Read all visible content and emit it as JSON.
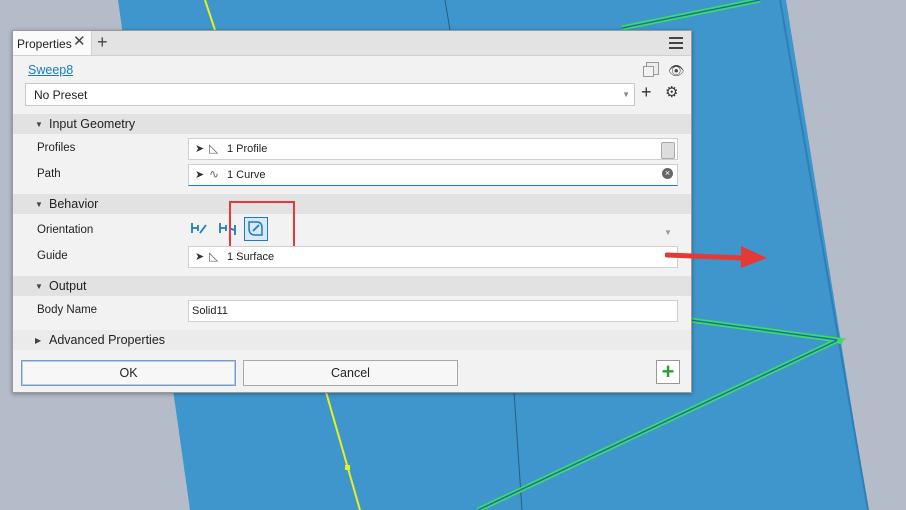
{
  "tab": {
    "label": "Properties"
  },
  "feature": {
    "name": "Sweep8"
  },
  "preset": {
    "value": "No Preset"
  },
  "sections": {
    "input_geometry": "Input Geometry",
    "behavior": "Behavior",
    "output": "Output",
    "advanced": "Advanced Properties"
  },
  "rows": {
    "profiles": {
      "label": "Profiles",
      "value": "1 Profile"
    },
    "path": {
      "label": "Path",
      "value": "1 Curve"
    },
    "orientation": {
      "label": "Orientation",
      "options": [
        "path-icon",
        "parallel-icon",
        "guide-icon"
      ],
      "selected": "guide-icon"
    },
    "guide": {
      "label": "Guide",
      "value": "1 Surface"
    },
    "body_name": {
      "label": "Body Name",
      "value": "Solid11"
    }
  },
  "buttons": {
    "ok": "OK",
    "cancel": "Cancel"
  },
  "colors": {
    "accent": "#1a7dc4",
    "highlight": "#e53935",
    "viewport_blue": "#3f96cc",
    "add_green": "#2e9b3a"
  }
}
